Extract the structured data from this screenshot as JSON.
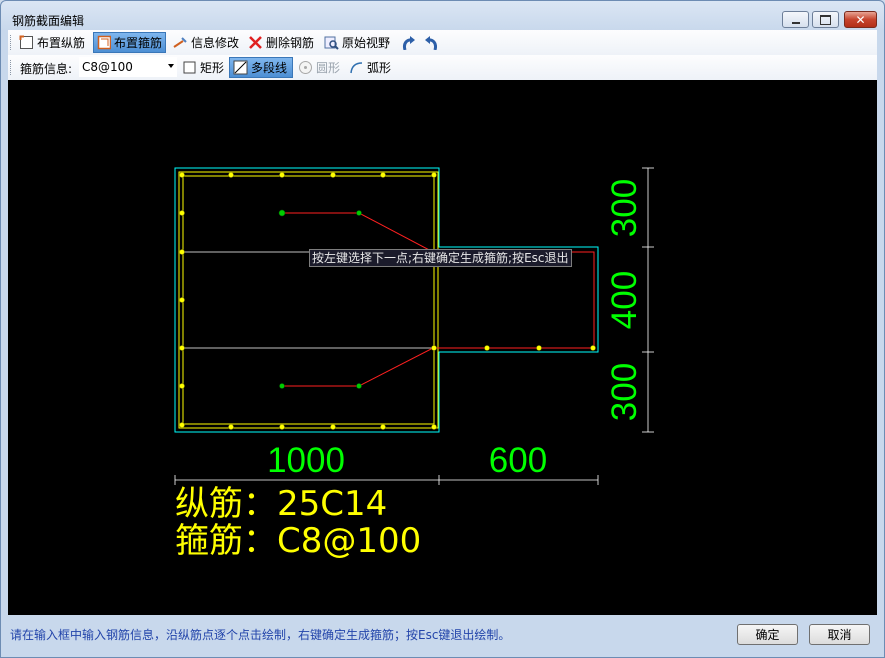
{
  "window": {
    "title": "钢筋截面编辑"
  },
  "toolbar1": {
    "items": [
      {
        "label": "布置纵筋",
        "icon": "rebar-place-icon"
      },
      {
        "label": "布置箍筋",
        "icon": "stirrup-place-icon",
        "active": true
      },
      {
        "label": "信息修改",
        "icon": "edit-info-icon"
      },
      {
        "label": "删除钢筋",
        "icon": "delete-icon"
      },
      {
        "label": "原始视野",
        "icon": "zoom-reset-icon"
      }
    ],
    "undo_icon": "undo-icon",
    "redo_icon": "redo-icon"
  },
  "toolbar2": {
    "stirrup_info_label": "箍筋信息:",
    "stirrup_value": "C8@100",
    "shapes": [
      {
        "label": "矩形",
        "icon": "rectangle-icon"
      },
      {
        "label": "多段线",
        "icon": "polyline-icon",
        "active": true
      },
      {
        "label": "圆形",
        "icon": "circle-icon",
        "disabled": true
      },
      {
        "label": "弧形",
        "icon": "arc-icon"
      }
    ]
  },
  "canvas": {
    "tooltip": "按左键选择下一点;右键确定生成箍筋;按Esc退出",
    "dims": {
      "bottom_left": "1000",
      "bottom_right": "600",
      "right_top": "300",
      "right_mid": "400",
      "right_bottom": "300"
    },
    "longitudinal_text": "纵筋：25C14",
    "stirrup_text": "箍筋：C8@100",
    "colors": {
      "dim": "#00ff00",
      "text": "#ffff00",
      "outline": "#00ffff",
      "stirrup": "#ff0000",
      "rebar": "#ffff00"
    }
  },
  "status": {
    "message": "请在输入框中输入钢筋信息，沿纵筋点逐个点击绘制，右键确定生成箍筋；按Esc键退出绘制。",
    "ok": "确定",
    "cancel": "取消"
  }
}
